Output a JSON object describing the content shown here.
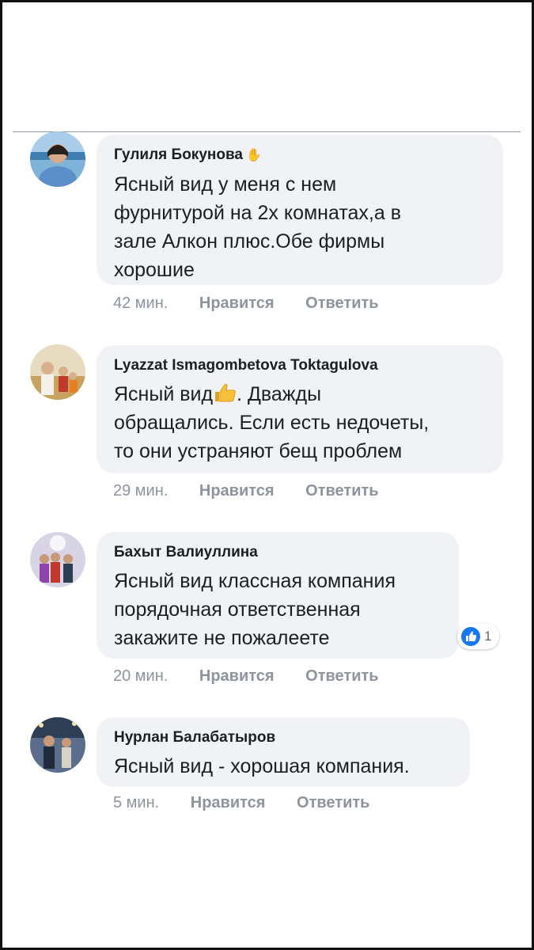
{
  "comments": [
    {
      "author": "Гулиля Бокунова",
      "author_icon": "wave-hand-icon",
      "text_lines": [
        "Ясный вид у меня с нем",
        "фурнитурой на 2х комнатах,а в",
        "зале Алкон плюс.Обе фирмы",
        "хорошие"
      ],
      "time": "42 мин.",
      "like_label": "Нравится",
      "reply_label": "Ответить"
    },
    {
      "author": "Lyazzat Ismagombetova Toktagulova",
      "text_lines": [
        "Ясный вид",
        ". Дважды",
        "обращались. Если есть недочеты,",
        "то они устраняют бещ проблем"
      ],
      "inline_icon": "thumbs-up-emoji-icon",
      "time": "29 мин.",
      "like_label": "Нравится",
      "reply_label": "Ответить"
    },
    {
      "author": "Бахыт Валиуллина",
      "text_lines": [
        "Ясный вид классная компания",
        "порядочная ответственная",
        "закажите не пожалеете"
      ],
      "reaction": {
        "icon": "like-reaction-icon",
        "count": "1",
        "color": "#1877f2"
      },
      "time": "20 мин.",
      "like_label": "Нравится",
      "reply_label": "Ответить"
    },
    {
      "author": "Нурлан Балабатыров",
      "text_lines": [
        "Ясный вид - хорошая компания."
      ],
      "time": "5 мин.",
      "like_label": "Нравится",
      "reply_label": "Ответить"
    }
  ],
  "colors": {
    "bubble": "#f0f2f5",
    "meta_text": "#8d949e",
    "text": "#1c1e21",
    "like_blue": "#1877f2"
  }
}
